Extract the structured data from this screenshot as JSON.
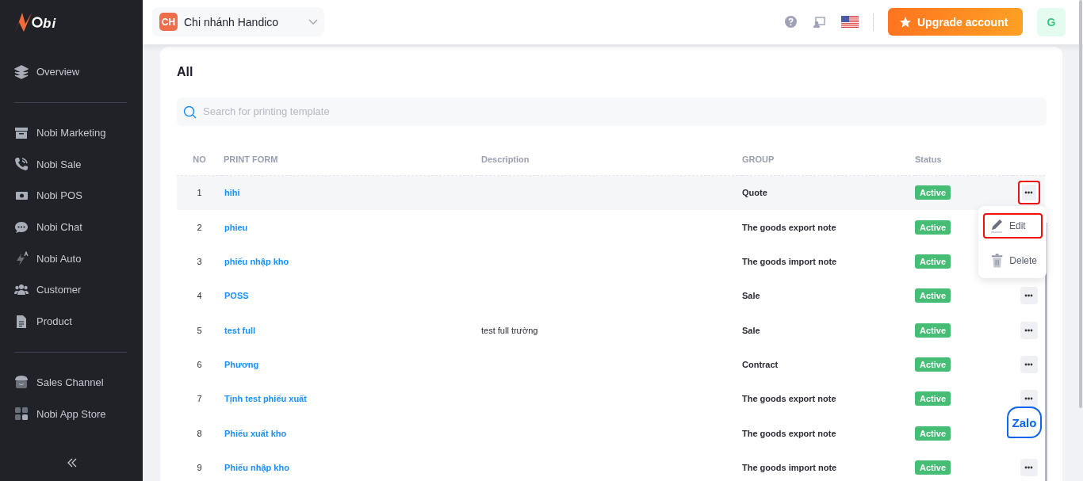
{
  "sidebar": {
    "logo_text": "bi",
    "groups": [
      [
        {
          "label": "Overview",
          "kind": "layers",
          "selected": false
        }
      ],
      [
        {
          "label": "Nobi Marketing",
          "kind": "archive",
          "selected": false
        },
        {
          "label": "Nobi Sale",
          "kind": "phone",
          "selected": false
        },
        {
          "label": "Nobi POS",
          "kind": "cash",
          "selected": false
        },
        {
          "label": "Nobi Chat",
          "kind": "chat",
          "selected": false
        },
        {
          "label": "Nobi Auto",
          "kind": "bolt",
          "selected": false
        },
        {
          "label": "Customer",
          "kind": "users",
          "selected": false
        },
        {
          "label": "Product",
          "kind": "file",
          "selected": false
        }
      ],
      [
        {
          "label": "Sales Channel",
          "kind": "store",
          "selected": false
        },
        {
          "label": "Nobi App Store",
          "kind": "apps",
          "selected": false
        }
      ]
    ]
  },
  "topbar": {
    "branch": {
      "initials": "CH",
      "name": "Chi nhánh Handico"
    },
    "upgrade_button": "Upgrade account",
    "avatar": "G"
  },
  "content": {
    "title": "All",
    "search": {
      "placeholder": "Search for printing template"
    },
    "columns": [
      "NO",
      "PRINT FORM",
      "Description",
      "GROUP",
      "Status"
    ],
    "rows": [
      {
        "no": "1",
        "name": "hihi",
        "group": "Quote",
        "status": "Active",
        "menu_open": true
      },
      {
        "no": "2",
        "name": "phieu",
        "group": "The goods export note",
        "status": "Active"
      },
      {
        "no": "3",
        "name": "phiếu nhập kho",
        "group": "The goods import note",
        "status": "Active"
      },
      {
        "no": "4",
        "name": "POSS",
        "group": "Sale",
        "status": "Active",
        "menu_open": false
      },
      {
        "no": "5",
        "name": "test full",
        "description": "test full trường",
        "group": "Sale",
        "status": "Active",
        "menu_open": false
      },
      {
        "no": "6",
        "name": "Phương",
        "group": "Contract",
        "status": "Active",
        "menu_open": false
      },
      {
        "no": "7",
        "name": "Tịnh test phiếu xuất",
        "group": "The goods export note",
        "status": "Active",
        "menu_open": false
      },
      {
        "no": "8",
        "name": "Phiếu xuất kho",
        "group": "The goods export note",
        "status": "Active"
      },
      {
        "no": "9",
        "name": "Phiếu nhập kho",
        "group": "The goods import note",
        "status": "Active",
        "menu_open": false
      }
    ],
    "row_menu": [
      {
        "label": "Edit",
        "kind": "edit",
        "outlined": true
      },
      {
        "label": "Delete",
        "kind": "delete",
        "outlined": false
      }
    ]
  },
  "chat_button": "Zalo"
}
